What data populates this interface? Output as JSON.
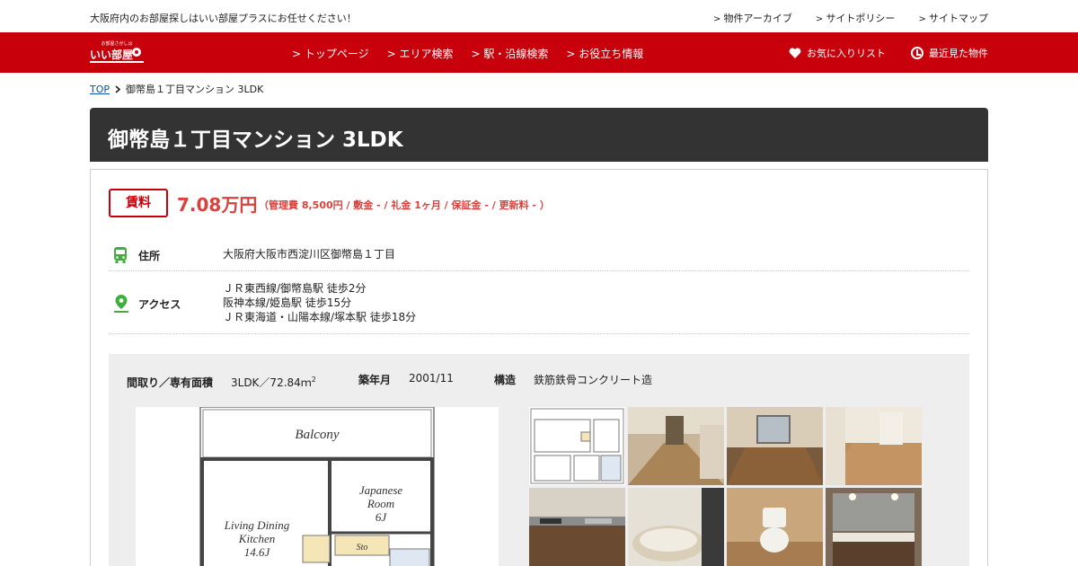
{
  "header": {
    "tagline": "大阪府内のお部屋探しはいい部屋プラスにお任せください！",
    "top_links": [
      "物件アーカイブ",
      "サイトポリシー",
      "サイトマップ"
    ]
  },
  "navbar": {
    "logo_small": "お部屋さがしは",
    "logo_main": "いい部屋",
    "logo_suffix": "プラス",
    "links": [
      "トップページ",
      "エリア検索",
      "駅・沿線検索",
      "お役立ち情報"
    ],
    "favorites": "お気に入りリスト",
    "recent": "最近見た物件"
  },
  "breadcrumb": {
    "home": "TOP",
    "current": "御幣島１丁目マンション 3LDK"
  },
  "property": {
    "title": "御幣島１丁目マンション  3LDK",
    "rent_label": "賃料",
    "rent_price": "7.08万円",
    "rent_detail": "（管理費 8,500円 / 敷金 - / 礼金 1ヶ月 / 保証金 - / 更新料 - ）",
    "address_label": "住所",
    "address": "大阪府大阪市西淀川区御幣島１丁目",
    "access_label": "アクセス",
    "access": [
      "ＪＲ東西線/御幣島駅 徒歩2分",
      "阪神本線/姫島駅 徒歩15分",
      "ＪＲ東海道・山陽本線/塚本駅 徒歩18分"
    ],
    "layout_label": "間取り／専有面積",
    "layout_value": "3LDK／72.84ｍ",
    "layout_sup": "2",
    "built_label": "築年月",
    "built_value": "2001/11",
    "structure_label": "構造",
    "structure_value": "鉄筋鉄骨コンクリート造"
  },
  "floorplan": {
    "balcony": "Balcony",
    "japanese_room": [
      "Japanese",
      "Room",
      "6J"
    ],
    "living": [
      "Living Dining",
      "Kitchen",
      "14.6J"
    ],
    "storage": "Sto"
  },
  "colors": {
    "brand": "#c8000b",
    "price": "#d9413d",
    "title_bg": "#333333",
    "icon": "#3fae3a"
  }
}
